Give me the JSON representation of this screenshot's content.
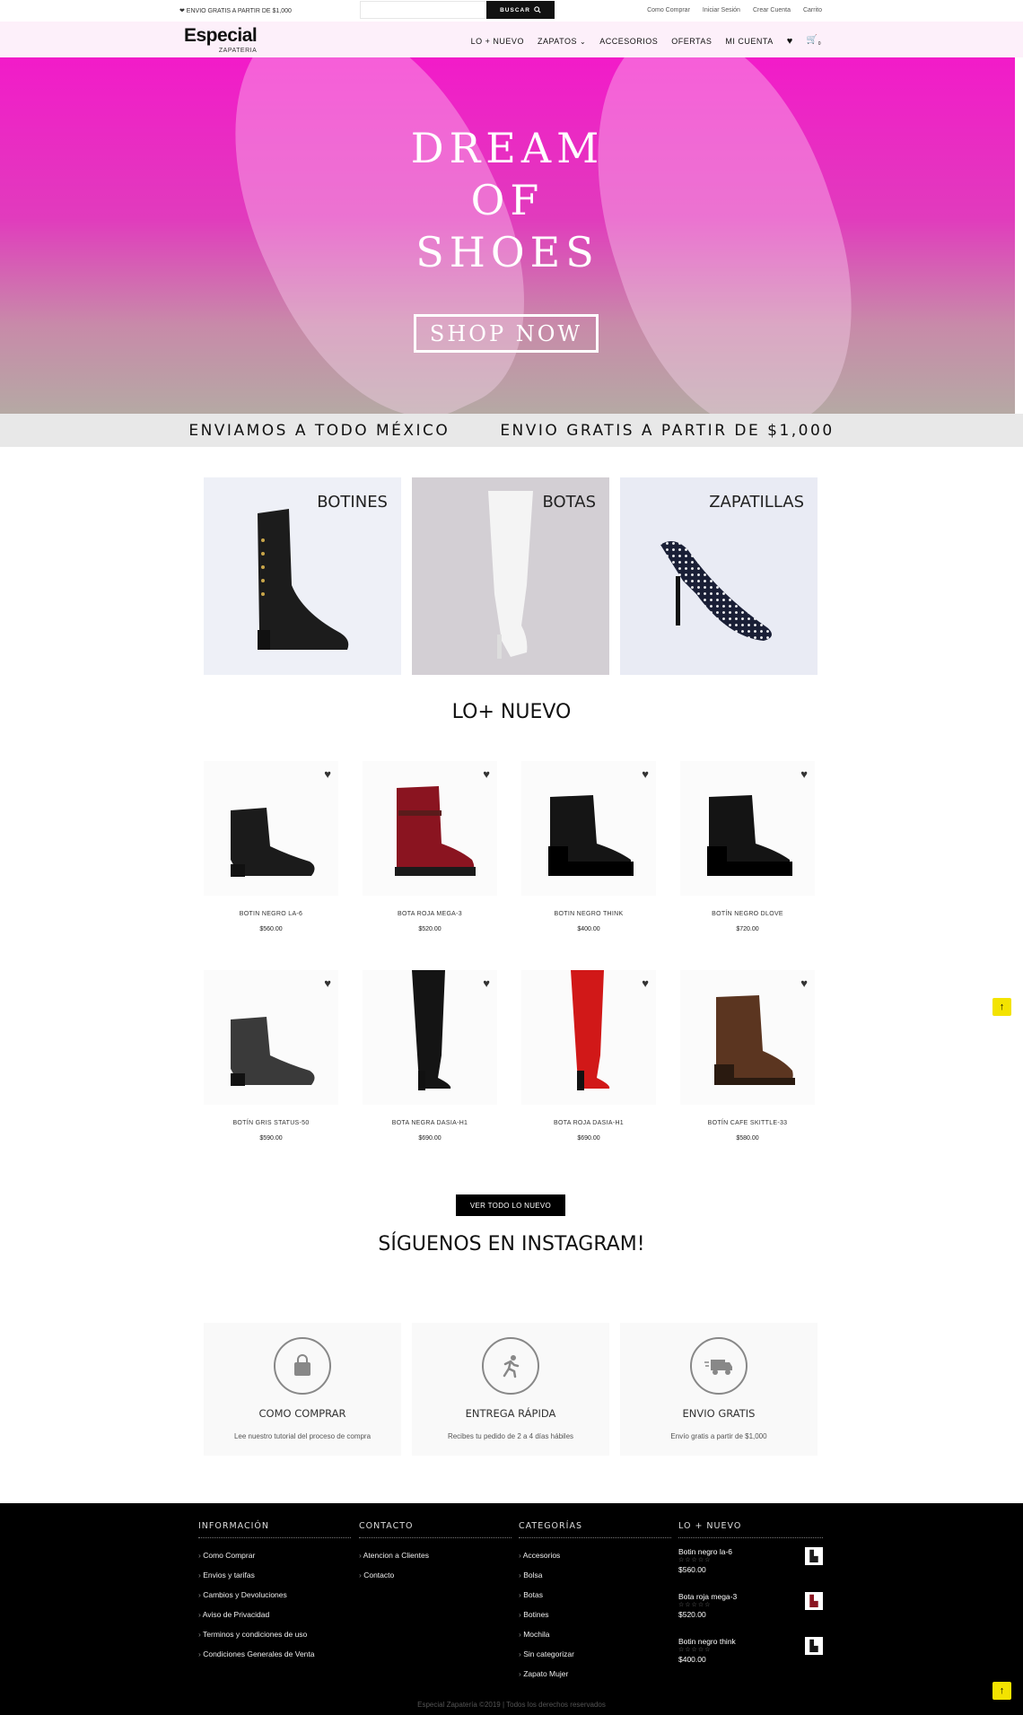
{
  "topbar": {
    "promo": "❤ ENVIO GRATIS A PARTIR DE $1,000",
    "search_placeholder": "",
    "search_button": "BUSCAR",
    "links": [
      "Como Comprar",
      "Iniciar Sesión",
      "Crear Cuenta",
      "Carrito"
    ]
  },
  "header": {
    "logo_main": "Especial",
    "logo_sub": "ZAPATERIA",
    "nav": [
      "LO + NUEVO",
      "ZAPATOS",
      "ACCESORIOS",
      "OFERTAS",
      "MI CUENTA"
    ],
    "cart_count": "0"
  },
  "hero": {
    "line1": "DREAM",
    "line2": "OF",
    "line3": "SHOES",
    "button": "SHOP NOW"
  },
  "shipping": {
    "left": "ENVIAMOS A TODO MÉXICO",
    "right": "ENVIO GRATIS A PARTIR DE $1,000"
  },
  "categories": [
    {
      "label": "BOTINES",
      "bg": "#eef0f7"
    },
    {
      "label": "BOTAS",
      "bg": "#d3cfd4"
    },
    {
      "label": "ZAPATILLAS",
      "bg": "#e9ebf4"
    }
  ],
  "new_title": "LO+ NUEVO",
  "products": [
    {
      "name": "BOTIN NEGRO LA-6",
      "price": "$560.00",
      "color": "#1b1b1b",
      "shape": "ankle"
    },
    {
      "name": "BOTA ROJA MEGA-3",
      "price": "$520.00",
      "color": "#8a1420",
      "shape": "combat"
    },
    {
      "name": "BOTIN NEGRO THINK",
      "price": "$400.00",
      "color": "#151515",
      "shape": "platform"
    },
    {
      "name": "BOTÍN NEGRO DLOVE",
      "price": "$720.00",
      "color": "#141414",
      "shape": "platform"
    },
    {
      "name": "BOTÍN GRIS STATUS-50",
      "price": "$590.00",
      "color": "#3a3a3a",
      "shape": "ankle"
    },
    {
      "name": "BOTA NEGRA DASIA-H1",
      "price": "$690.00",
      "color": "#141414",
      "shape": "tall"
    },
    {
      "name": "BOTA ROJA DASIA-H1",
      "price": "$690.00",
      "color": "#d11818",
      "shape": "tall"
    },
    {
      "name": "BOTÍN CAFE SKITTLE-33",
      "price": "$580.00",
      "color": "#5b3520",
      "shape": "laced"
    }
  ],
  "see_all": "VER TODO LO NUEVO",
  "instagram_title": "SÍGUENOS EN INSTAGRAM!",
  "features": [
    {
      "title": "COMO COMPRAR",
      "desc": "Lee nuestro tutorial del proceso de compra",
      "icon": "shopping-bag-icon"
    },
    {
      "title": "ENTREGA RÁPIDA",
      "desc": "Recibes tu pedido de 2 a 4 días hábiles",
      "icon": "running-person-icon"
    },
    {
      "title": "ENVIO GRATIS",
      "desc": "Envío gratis a partir de $1,000",
      "icon": "delivery-truck-icon"
    }
  ],
  "footer": {
    "info_title": "INFORMACIÓN",
    "info_links": [
      "Como Comprar",
      "Envios y tarifas",
      "Cambios y Devoluciones",
      "Aviso de Privacidad",
      "Terminos y condiciones de uso",
      "Condiciones Generales de Venta"
    ],
    "contact_title": "CONTACTO",
    "contact_links": [
      "Atencion a Clientes",
      "Contacto"
    ],
    "cat_title": "CATEGORÍAS",
    "cat_links": [
      "Accesorios",
      "Bolsa",
      "Botas",
      "Botines",
      "Mochila",
      "Sin categorizar",
      "Zapato Mujer"
    ],
    "new_title": "LO + NUEVO",
    "new_items": [
      {
        "name": "Botin negro la-6",
        "price": "$560.00",
        "stars": "☆☆☆☆☆"
      },
      {
        "name": "Bota roja mega-3",
        "price": "$520.00",
        "stars": "☆☆☆☆☆"
      },
      {
        "name": "Botin negro think",
        "price": "$400.00",
        "stars": "☆☆☆☆☆"
      }
    ],
    "copyright": "Especial Zapatería ©2019 | Todos los derechos reservados"
  },
  "colors": {
    "accent": "#f21bc9",
    "scroll_top": "#f3e300"
  }
}
